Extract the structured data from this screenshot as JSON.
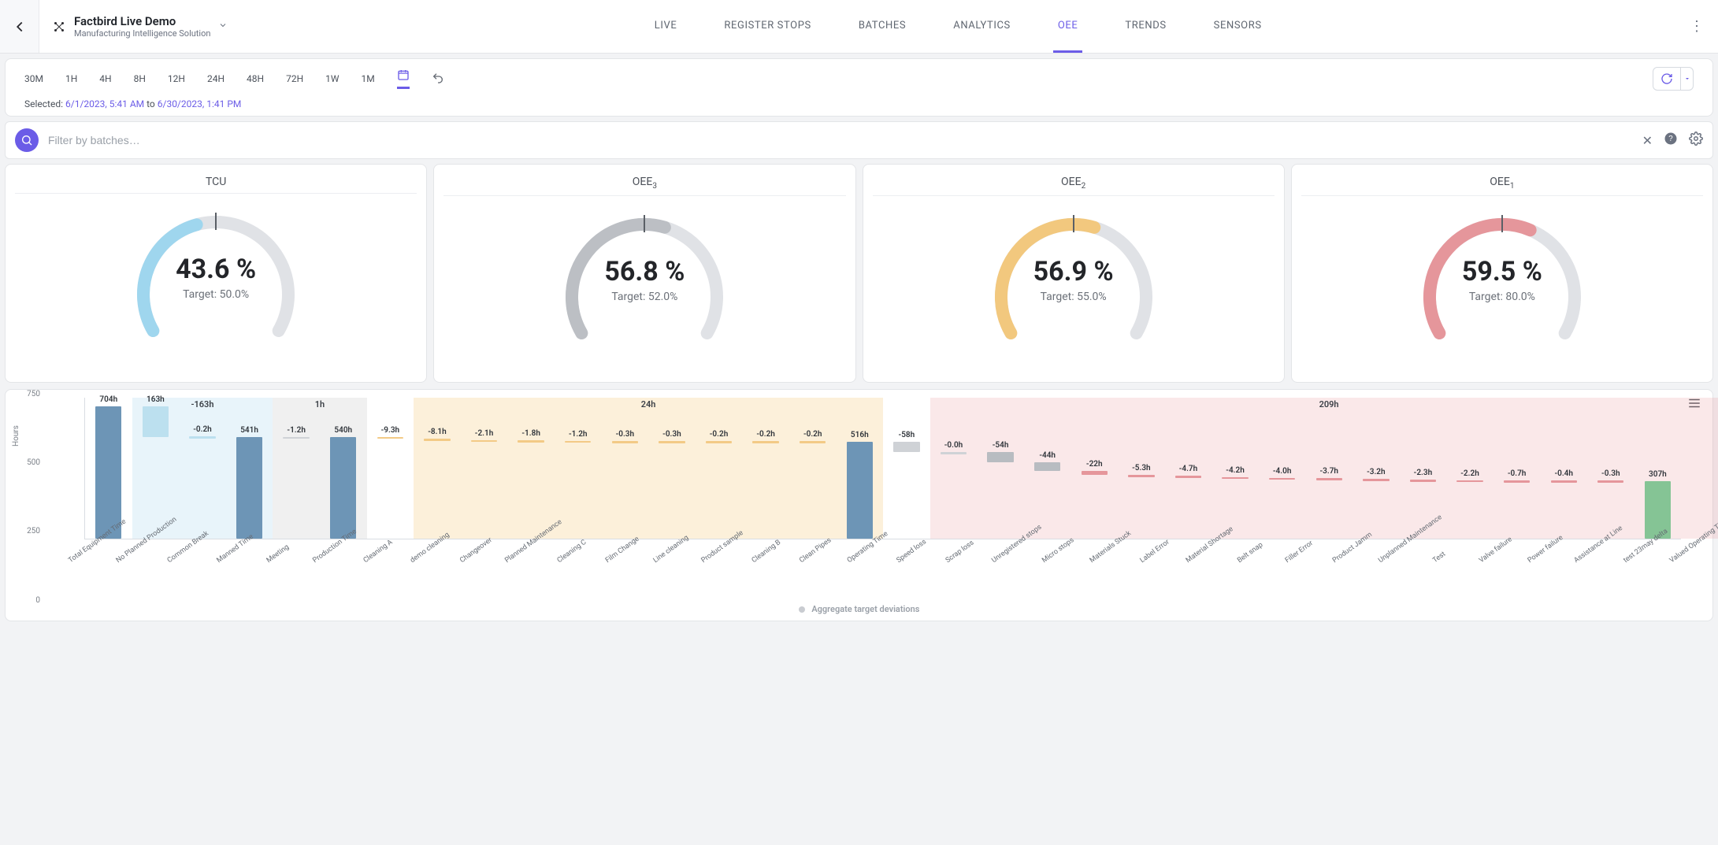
{
  "header": {
    "product_title": "Factbird Live Demo",
    "product_subtitle": "Manufacturing Intelligence Solution",
    "tabs": [
      {
        "label": "LIVE",
        "active": false
      },
      {
        "label": "REGISTER STOPS",
        "active": false
      },
      {
        "label": "BATCHES",
        "active": false
      },
      {
        "label": "ANALYTICS",
        "active": false
      },
      {
        "label": "OEE",
        "active": true
      },
      {
        "label": "TRENDS",
        "active": false
      },
      {
        "label": "SENSORS",
        "active": false
      }
    ]
  },
  "range": {
    "buttons": [
      "30M",
      "1H",
      "4H",
      "8H",
      "12H",
      "24H",
      "48H",
      "72H",
      "1W",
      "1M"
    ],
    "selected_label": "Selected:",
    "from": "6/1/2023, 5:41 AM",
    "to_label": "to",
    "to": "6/30/2023, 1:41 PM"
  },
  "filter": {
    "placeholder": "Filter by batches…"
  },
  "gauges": [
    {
      "id": "tcu",
      "title": "TCU",
      "sub": "",
      "value": "43.6 %",
      "target_label": "Target:",
      "target": "50.0%",
      "percent": 43.6,
      "color": "#9fd6ee"
    },
    {
      "id": "oee3",
      "title": "OEE",
      "sub": "3",
      "value": "56.8 %",
      "target_label": "Target:",
      "target": "52.0%",
      "percent": 56.8,
      "color": "#bcbfc4"
    },
    {
      "id": "oee2",
      "title": "OEE",
      "sub": "2",
      "value": "56.9 %",
      "target_label": "Target:",
      "target": "55.0%",
      "percent": 56.9,
      "color": "#f2c87e"
    },
    {
      "id": "oee1",
      "title": "OEE",
      "sub": "1",
      "value": "59.5 %",
      "target_label": "Target:",
      "target": "80.0%",
      "percent": 59.5,
      "color": "#e5969b"
    }
  ],
  "chart_data": {
    "type": "bar",
    "ylabel": "Hours",
    "yticks": [
      "750",
      "500",
      "250",
      "0"
    ],
    "ylim": [
      0,
      750
    ],
    "legend": "Aggregate target deviations",
    "zones": [
      {
        "cls": "zone-blue",
        "from": 1,
        "to": 3,
        "label": "-163h"
      },
      {
        "cls": "zone-gray",
        "from": 4,
        "to": 5,
        "label": "1h"
      },
      {
        "cls": "zone-amber",
        "from": 7,
        "to": 16,
        "label": "24h"
      },
      {
        "cls": "zone-pink",
        "from": 18,
        "to": 34,
        "label": "209h"
      }
    ],
    "bars": [
      {
        "name": "Total Equipment Time",
        "label": "704h",
        "top": 704,
        "bottom": 0,
        "color": "#6d95b6"
      },
      {
        "name": "No Planned Production",
        "label": "163h",
        "top": 704,
        "bottom": 541,
        "color": "#bce0ef"
      },
      {
        "name": "Common Break",
        "label": "-0.2h",
        "top": 542,
        "bottom": 541,
        "color": "#bce0ef",
        "thin": true
      },
      {
        "name": "Manned Time",
        "label": "541h",
        "top": 541,
        "bottom": 0,
        "color": "#6d95b6"
      },
      {
        "name": "Meeting",
        "label": "-1.2h",
        "top": 541,
        "bottom": 540,
        "color": "#cfd2d6",
        "thin": true
      },
      {
        "name": "Production Time",
        "label": "540h",
        "top": 540,
        "bottom": 0,
        "color": "#6d95b6"
      },
      {
        "name": "Cleaning A",
        "label": "-9.3h",
        "top": 540,
        "bottom": 531,
        "color": "#f3ca86",
        "thin": true
      },
      {
        "name": "demo cleaning",
        "label": "-8.1h",
        "top": 531,
        "bottom": 523,
        "color": "#f3ca86",
        "thin": true
      },
      {
        "name": "Changeover",
        "label": "-2.1h",
        "top": 523,
        "bottom": 521,
        "color": "#f3ca86",
        "thin": true
      },
      {
        "name": "Planned Maintenance",
        "label": "-1.8h",
        "top": 521,
        "bottom": 519,
        "color": "#f3ca86",
        "thin": true
      },
      {
        "name": "Cleaning C",
        "label": "-1.2h",
        "top": 519,
        "bottom": 518,
        "color": "#f3ca86",
        "thin": true
      },
      {
        "name": "Film Change",
        "label": "-0.3h",
        "top": 518,
        "bottom": 517.7,
        "color": "#f3ca86",
        "thin": true
      },
      {
        "name": "Line cleaning",
        "label": "-0.3h",
        "top": 517.7,
        "bottom": 517.4,
        "color": "#f3ca86",
        "thin": true
      },
      {
        "name": "Product sample",
        "label": "-0.2h",
        "top": 517.4,
        "bottom": 517.2,
        "color": "#f3ca86",
        "thin": true
      },
      {
        "name": "Cleaning B",
        "label": "-0.2h",
        "top": 517.2,
        "bottom": 517,
        "color": "#f3ca86",
        "thin": true
      },
      {
        "name": "Clean Pipes",
        "label": "-0.2h",
        "top": 517,
        "bottom": 516.8,
        "color": "#f3ca86",
        "thin": true
      },
      {
        "name": "Operating Time",
        "label": "516h",
        "top": 516,
        "bottom": 0,
        "color": "#6d95b6"
      },
      {
        "name": "Speed loss",
        "label": "-58h",
        "top": 516,
        "bottom": 458,
        "color": "#cfd2d6"
      },
      {
        "name": "Scrap loss",
        "label": "-0.0h",
        "top": 458,
        "bottom": 458,
        "color": "#cfd2d6",
        "thin": true
      },
      {
        "name": "Unregistered stops",
        "label": "-54h",
        "top": 458,
        "bottom": 404,
        "color": "#b8bcc1"
      },
      {
        "name": "Micro stops",
        "label": "-44h",
        "top": 404,
        "bottom": 360,
        "color": "#b8bcc1"
      },
      {
        "name": "Materials Stuck",
        "label": "-22h",
        "top": 360,
        "bottom": 338,
        "color": "#e5969b",
        "thin": true
      },
      {
        "name": "Label Error",
        "label": "-5.3h",
        "top": 338,
        "bottom": 332.7,
        "color": "#e5969b",
        "thin": true
      },
      {
        "name": "Material Shortage",
        "label": "-4.7h",
        "top": 332.7,
        "bottom": 328,
        "color": "#e5969b",
        "thin": true
      },
      {
        "name": "Belt snap",
        "label": "-4.2h",
        "top": 328,
        "bottom": 323.8,
        "color": "#e5969b",
        "thin": true
      },
      {
        "name": "Filler Error",
        "label": "-4.0h",
        "top": 323.8,
        "bottom": 319.8,
        "color": "#e5969b",
        "thin": true
      },
      {
        "name": "Product Jamm",
        "label": "-3.7h",
        "top": 319.8,
        "bottom": 316.1,
        "color": "#e5969b",
        "thin": true
      },
      {
        "name": "Unplanned Maintenance",
        "label": "-3.2h",
        "top": 316.1,
        "bottom": 312.9,
        "color": "#e5969b",
        "thin": true
      },
      {
        "name": "Test",
        "label": "-2.3h",
        "top": 312.9,
        "bottom": 310.6,
        "color": "#e5969b",
        "thin": true
      },
      {
        "name": "Valve failure",
        "label": "-2.2h",
        "top": 310.6,
        "bottom": 308.4,
        "color": "#e5969b",
        "thin": true
      },
      {
        "name": "Power failure",
        "label": "-0.7h",
        "top": 308.4,
        "bottom": 307.7,
        "color": "#e5969b",
        "thin": true
      },
      {
        "name": "Assistance at Line",
        "label": "-0.4h",
        "top": 307.7,
        "bottom": 307.3,
        "color": "#e5969b",
        "thin": true
      },
      {
        "name": "test 23may delta",
        "label": "-0.3h",
        "top": 307.3,
        "bottom": 307,
        "color": "#e5969b",
        "thin": true
      },
      {
        "name": "Valued Operating Time",
        "label": "307h",
        "top": 307,
        "bottom": 0,
        "color": "#85c495"
      }
    ]
  },
  "colors": {
    "accent": "#6b5ce7"
  }
}
